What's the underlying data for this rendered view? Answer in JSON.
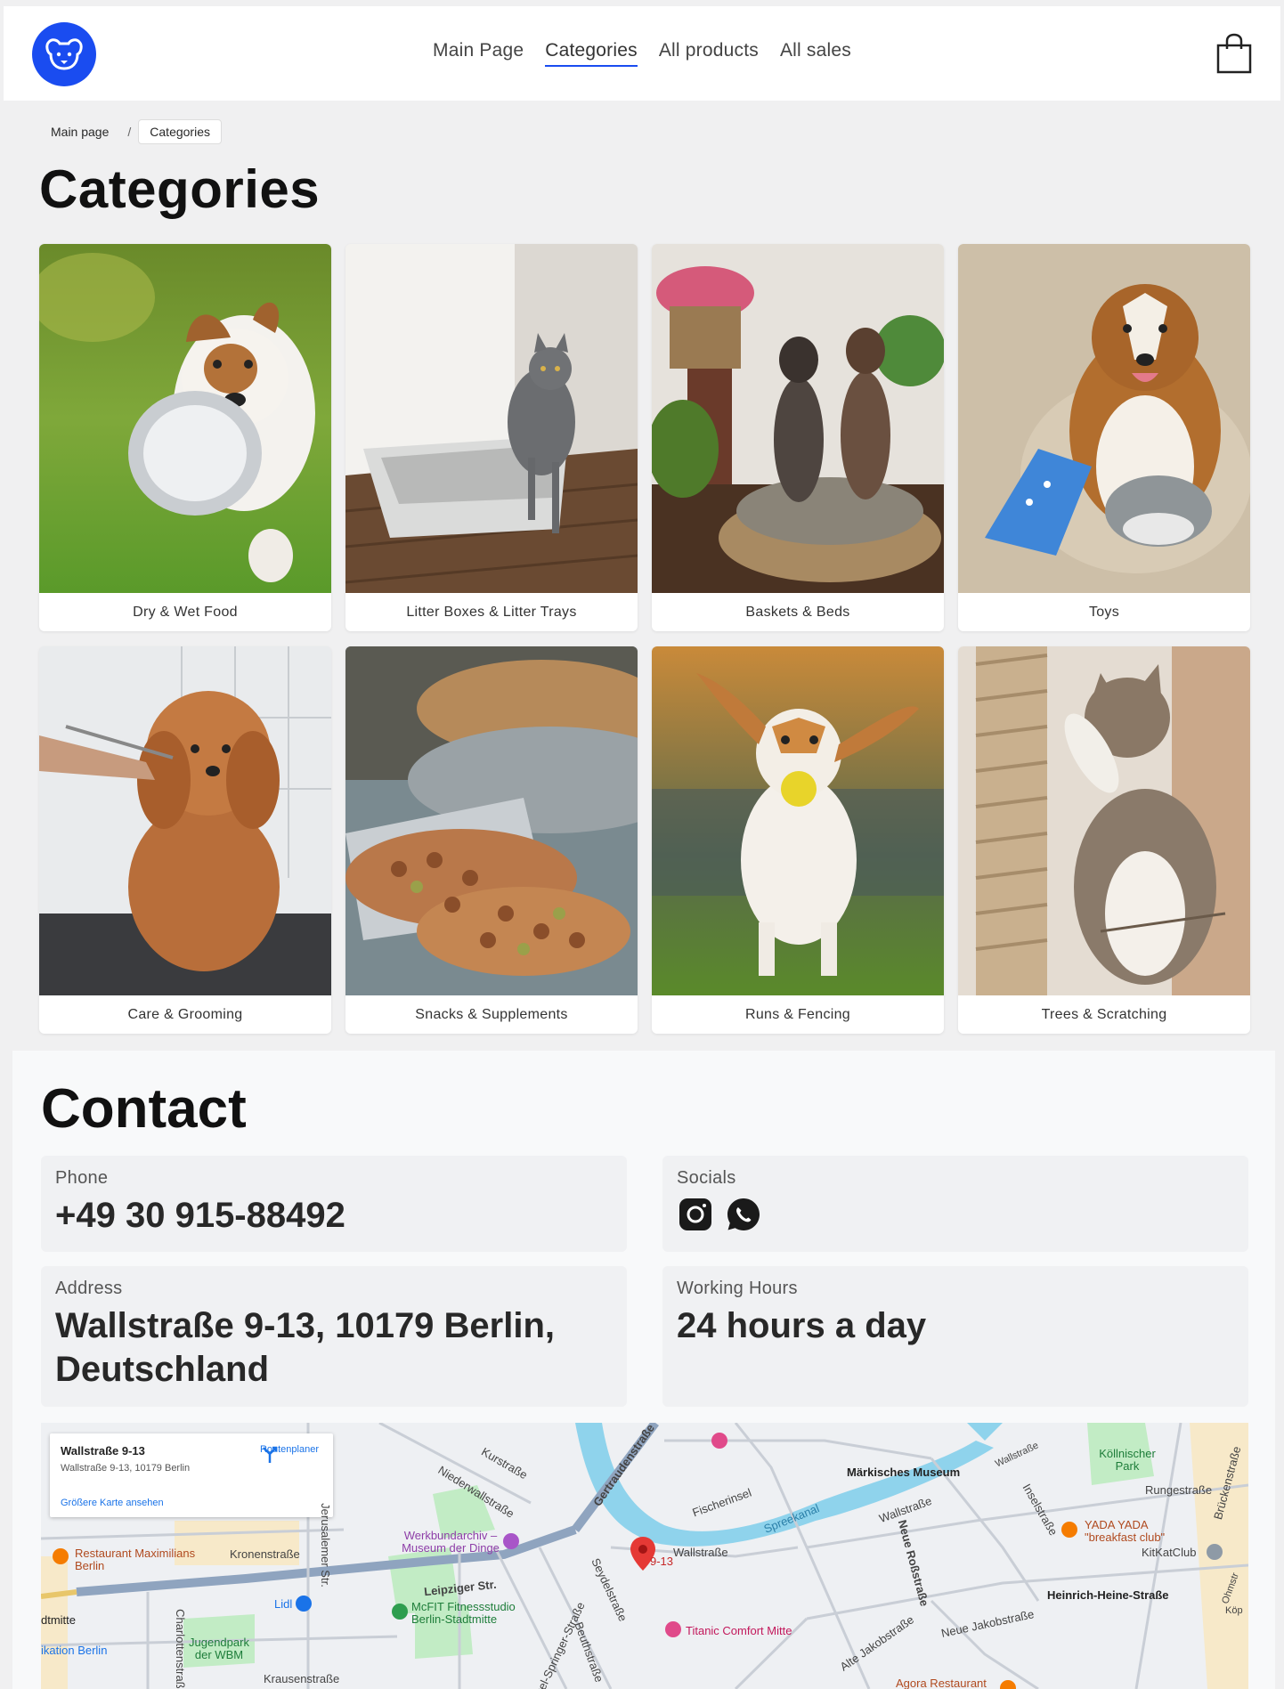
{
  "header": {
    "nav": [
      "Main Page",
      "Categories",
      "All products",
      "All sales"
    ],
    "active_nav": "Categories"
  },
  "breadcrumb": {
    "home": "Main page",
    "separator": "/",
    "current": "Categories"
  },
  "page_title": "Categories",
  "categories": [
    {
      "label": "Dry & Wet Food"
    },
    {
      "label": "Litter Boxes & Litter Trays"
    },
    {
      "label": "Baskets & Beds"
    },
    {
      "label": "Toys"
    },
    {
      "label": "Care & Grooming"
    },
    {
      "label": "Snacks & Supplements"
    },
    {
      "label": "Runs & Fencing"
    },
    {
      "label": "Trees & Scratching"
    }
  ],
  "contact": {
    "title": "Contact",
    "phone_label": "Phone",
    "phone_value": "+49 30 915-88492",
    "socials_label": "Socials",
    "address_label": "Address",
    "address_value": "Wallstraße 9-13, 10179 Berlin, Deutschland",
    "hours_label": "Working Hours",
    "hours_value": "24 hours a day"
  },
  "map": {
    "card_title": "Wallstraße 9-13",
    "card_address": "Wallstraße 9-13, 10179 Berlin",
    "card_link": "Größere Karte ansehen",
    "route_label": "Routenplaner",
    "pin_label": "9-13",
    "labels": {
      "kurstrasse": "Kurstraße",
      "niederwall": "Niederwallstraße",
      "gertrauden": "Gertraudenstraße",
      "fischerinsel": "Fischerinsel",
      "maerkisches": "Märkisches Museum",
      "wallstrasse1": "Wallstraße",
      "wallstrasse2": "Wallstraße",
      "wallstrasse3": "Wallstraße",
      "koellnischer": "Köllnischer Park",
      "rungestrasse": "Rungestraße",
      "inselstrasse": "Inselstraße",
      "brueckenstrasse": "Brückenstraße",
      "yada": "YADA YADA \"breakfast club\"",
      "kitkat": "KitKatClub",
      "werkbund": "Werkbundarchiv – Museum der Dinge",
      "restaurant": "Restaurant Maximilians Berlin",
      "kronenstrasse": "Kronenstraße",
      "jerusalemer": "Jerusalemer Str.",
      "leipziger": "Leipziger Str.",
      "lidl": "Lidl",
      "mcfit": "McFIT Fitnessstudio Berlin-Stadtmitte",
      "seydel": "Seydelstraße",
      "spreekanal": "Spreekanal",
      "neue_ross": "Neue Roßstraße",
      "heinrich": "Heinrich-Heine-Straße",
      "neue_jakob": "Neue Jakobstraße",
      "alte_jakob": "Alte Jakobstraße",
      "titanic": "Titanic Comfort Mitte",
      "jugendpark": "Jugendpark der WBM",
      "krausen": "Krausenstraße",
      "springer": "Axel-Springer-Straße",
      "beuth": "Beuthstraße",
      "charlotten": "Charlottenstraße",
      "agora": "Agora Restaurant",
      "stadtmitte": "dtmitte",
      "kommunikation": "ikation Berlin",
      "ohm": "Ohmstr",
      "koep": "Köp"
    }
  },
  "colors": {
    "brand_blue": "#1a4cf0",
    "page_bg": "#f0f0f1",
    "contact_bg": "#f8f9fa",
    "map_water": "#8fd3ec",
    "map_park": "#c2ecc5"
  }
}
